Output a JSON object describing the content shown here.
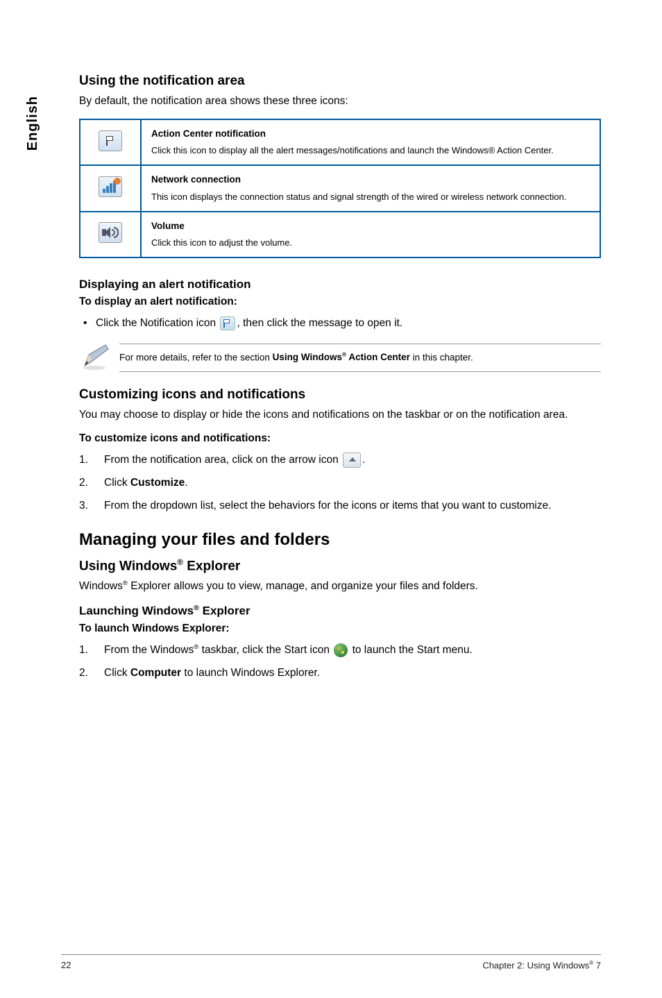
{
  "sideTab": "English",
  "h_notif_area": "Using the notification area",
  "p_notif_area": "By default, the notification area shows these three icons:",
  "table": {
    "row1_title": "Action Center notification",
    "row1_body": "Click this icon to display all the alert messages/notifications and launch the Windows® Action Center.",
    "row2_title": "Network connection",
    "row2_body": "This icon displays the connection status and signal strength of the wired or wireless network connection.",
    "row3_title": "Volume",
    "row3_body": "Click this icon to adjust the volume."
  },
  "h_display_alert": "Displaying an alert notification",
  "p_display_sub": "To display an alert notification:",
  "bullet_click_pre": "Click the Notification icon ",
  "bullet_click_post": ", then click the message to open it.",
  "note_pre": "For more details, refer to the section ",
  "note_bold": "Using Windows® Action Center",
  "note_post": " in this chapter.",
  "h_customize": "Customizing icons and notifications",
  "p_customize_body": "You may choose to display or hide the icons and notifications on the taskbar or on the notification area.",
  "p_customize_sub": "To customize icons and notifications:",
  "ol_customize": {
    "s1_pre": "From the notification area, click on the arrow icon ",
    "s1_post": ".",
    "s2_pre": "Click ",
    "s2_bold": "Customize",
    "s2_post": ".",
    "s3": "From the dropdown list, select the behaviors for the icons or items that you want to customize."
  },
  "h_managing": "Managing your files and folders",
  "h_using_explorer": "Using Windows® Explorer",
  "p_explorer_body": "Windows® Explorer allows you to view, manage, and organize your files and folders.",
  "h_launch_explorer": "Launching Windows® Explorer",
  "p_launch_sub": "To launch Windows Explorer:",
  "ol_launch": {
    "s1_pre": "From the Windows® taskbar, click the Start icon ",
    "s1_post": " to launch the Start menu.",
    "s2_pre": "Click ",
    "s2_bold": "Computer",
    "s2_post": " to launch Windows Explorer."
  },
  "footer": {
    "page": "22",
    "chapter": "Chapter 2: Using Windows® 7"
  }
}
